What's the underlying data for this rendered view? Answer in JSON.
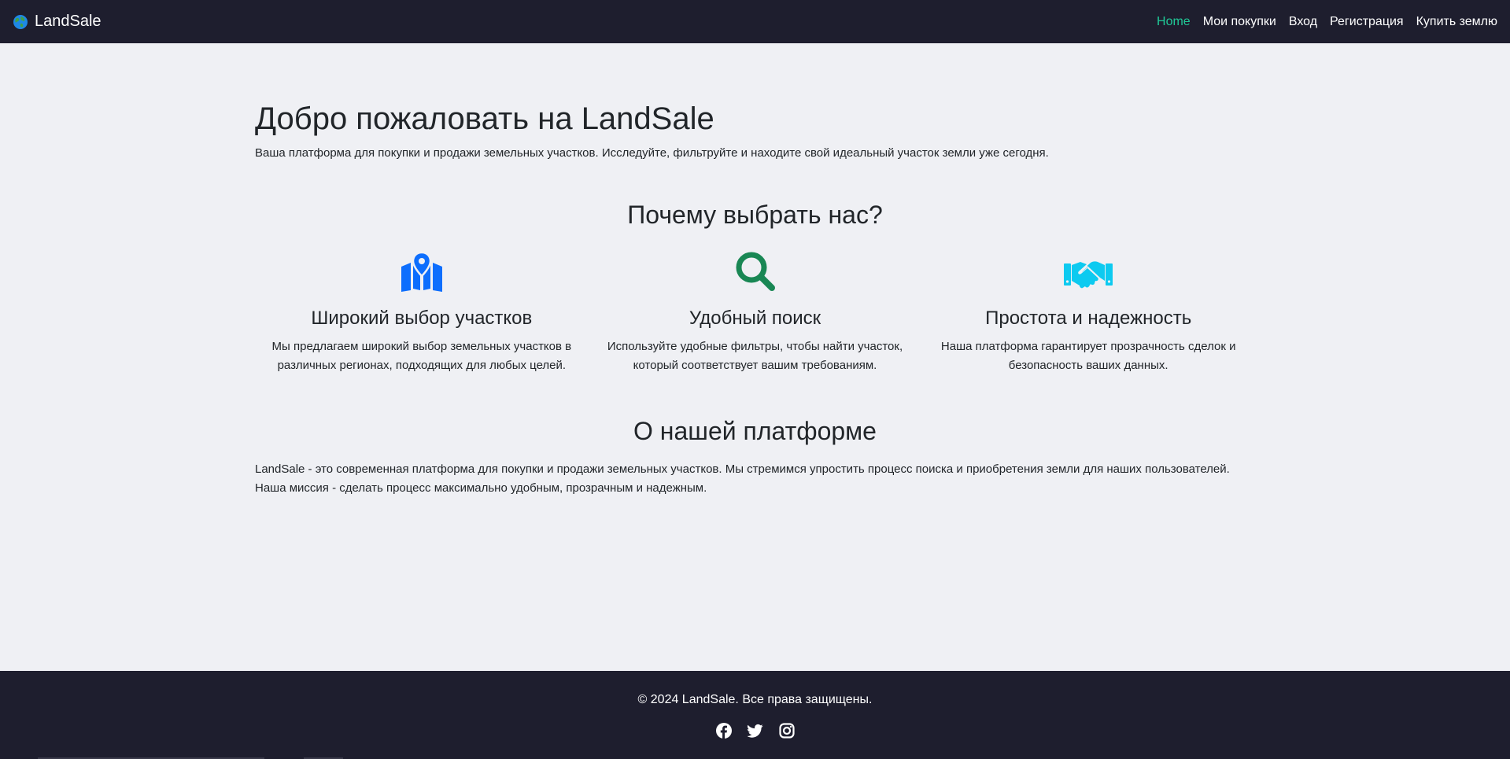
{
  "navbar": {
    "brand": "LandSale",
    "links": [
      {
        "label": "Home",
        "active": true
      },
      {
        "label": "Мои покупки"
      },
      {
        "label": "Вход"
      },
      {
        "label": "Регистрация"
      },
      {
        "label": "Купить землю"
      }
    ]
  },
  "hero": {
    "title": "Добро пожаловать на LandSale",
    "lead": "Ваша платформа для покупки и продажи земельных участков. Исследуйте, фильтруйте и находите свой идеальный участок земли уже сегодня."
  },
  "why": {
    "title": "Почему выбрать нас?",
    "features": [
      {
        "icon": "map-marker-icon",
        "icon_color": "#0d6efd",
        "title": "Широкий выбор участков",
        "text": "Мы предлагаем широкий выбор земельных участков в различных регионах, подходящих для любых целей."
      },
      {
        "icon": "search-icon",
        "icon_color": "#198754",
        "title": "Удобный поиск",
        "text": "Используйте удобные фильтры, чтобы найти участок, который соответствует вашим требованиям."
      },
      {
        "icon": "handshake-icon",
        "icon_color": "#0dcaf0",
        "title": "Простота и надежность",
        "text": "Наша платформа гарантирует прозрачность сделок и безопасность ваших данных."
      }
    ]
  },
  "about": {
    "title": "О нашей платформе",
    "text": "LandSale - это современная платформа для покупки и продажи земельных участков. Мы стремимся упростить процесс поиска и приобретения земли для наших пользователей. Наша миссия - сделать процесс максимально удобным, прозрачным и надежным."
  },
  "footer": {
    "copyright": "© 2024 LandSale. Все права защищены.",
    "socials": [
      "facebook-icon",
      "twitter-icon",
      "instagram-icon"
    ]
  },
  "colors": {
    "nav_bg": "#1e1e2e",
    "page_bg": "#eff0f4",
    "active_link": "#20c997"
  }
}
